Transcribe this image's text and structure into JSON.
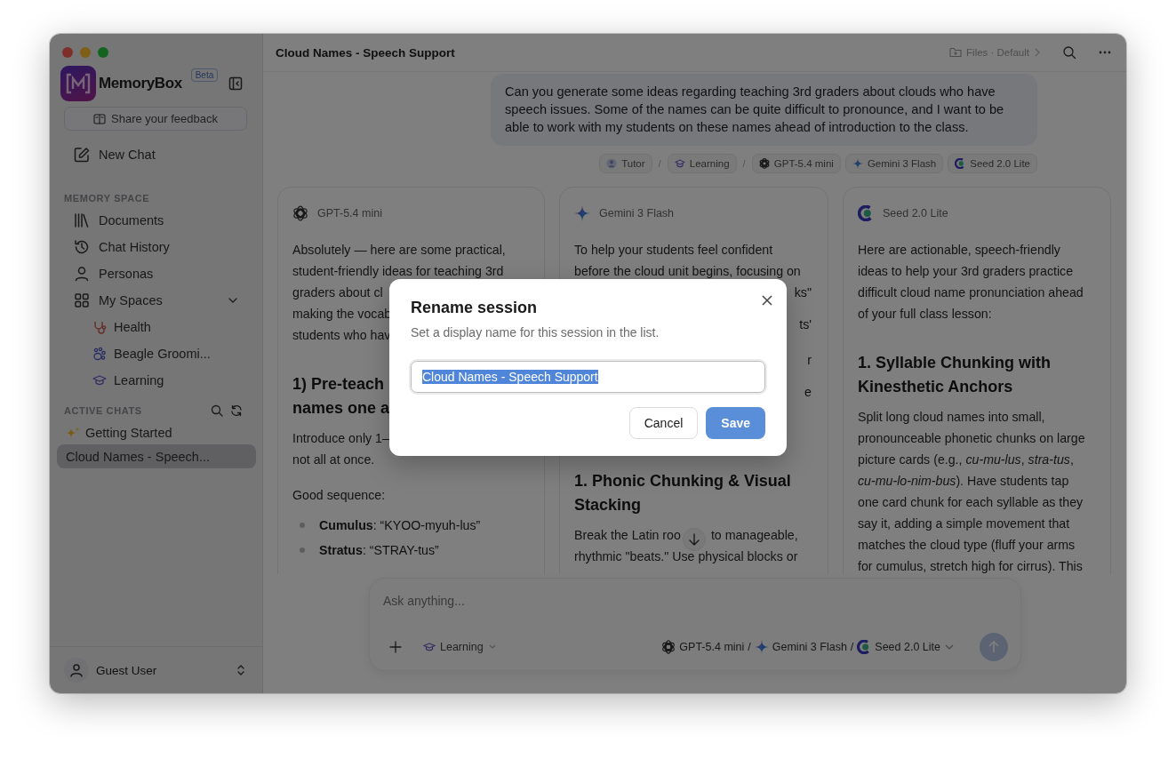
{
  "sidebar": {
    "brand": "MemoryBox",
    "badge": "Beta",
    "feedback": "Share your feedback",
    "new_chat": "New Chat",
    "memory_space": {
      "heading": "MEMORY SPACE",
      "items": [
        {
          "label": "Documents"
        },
        {
          "label": "Chat History"
        },
        {
          "label": "Personas"
        },
        {
          "label": "My Spaces",
          "expanded": true,
          "children": [
            {
              "label": "Health"
            },
            {
              "label": "Beagle Groomi..."
            },
            {
              "label": "Learning"
            }
          ]
        }
      ]
    },
    "active_chats": {
      "heading": "ACTIVE CHATS",
      "items": [
        {
          "label": "Getting Started",
          "selected": false
        },
        {
          "label": "Cloud Names - Speech...",
          "selected": true
        }
      ]
    },
    "user": "Guest User"
  },
  "header": {
    "title": "Cloud Names - Speech Support",
    "files": "Files · Default"
  },
  "message": {
    "text": "Can you generate some ideas regarding teaching 3rd graders about clouds who have speech issues.  Some of the names can be quite difficult to pronounce, and I want to be able to work with my students on these names ahead of introduction to the class.",
    "tags": [
      {
        "kind": "tag",
        "label": "Tutor"
      },
      {
        "kind": "sep",
        "label": "/"
      },
      {
        "kind": "tag",
        "label": "Learning"
      },
      {
        "kind": "sep",
        "label": "/"
      },
      {
        "kind": "model",
        "label": "GPT-5.4 mini"
      },
      {
        "kind": "model",
        "label": "Gemini 3 Flash"
      },
      {
        "kind": "model",
        "label": "Seed 2.0 Lite"
      }
    ]
  },
  "cards": [
    {
      "model": "GPT-5.4 mini",
      "blocks": [
        {
          "kind": "p",
          "lines": [
            "Absolutely — here are some practical,",
            "student-friendly ideas for teaching 3rd",
            "graders about cl",
            "making the vocab",
            "students who hav"
          ]
        },
        {
          "kind": "h",
          "lines": [
            "1) Pre-teach",
            "names one a"
          ]
        },
        {
          "kind": "p",
          "lines": [
            "Introduce only 1–",
            "not all at once."
          ]
        },
        {
          "kind": "p",
          "lines": [
            "Good sequence:"
          ]
        },
        {
          "kind": "bullet",
          "text": "**Cumulus**: “KYOO-myuh-lus”"
        },
        {
          "kind": "bullet",
          "text": "**Stratus**: “STRAY-tus”"
        }
      ]
    },
    {
      "model": "Gemini 3 Flash",
      "blocks": [
        {
          "kind": "p",
          "lines": [
            "To help your students feel confident",
            "before the cloud unit begins, focusing on"
          ]
        },
        {
          "kind": "covered",
          "lines": [
            "ks\"",
            "ts'"
          ]
        },
        {
          "kind": "covered",
          "lines": [
            "r",
            "e"
          ]
        },
        {
          "kind": "h",
          "lines": [
            "1. Phonic Chunking & Visual",
            "Stacking"
          ]
        },
        {
          "kind": "p",
          "lines": [
            [
              "Break the Latin roo",
              "to manageable,"
            ],
            "rhythmic \"beats.\" Use physical blocks or"
          ]
        }
      ]
    },
    {
      "model": "Seed 2.0 Lite",
      "blocks": [
        {
          "kind": "p",
          "lines": [
            "Here are actionable, speech-friendly",
            "ideas to help your 3rd graders practice",
            "difficult cloud name pronunciation ahead",
            "of your full class lesson:"
          ]
        },
        {
          "kind": "h",
          "lines": [
            "1. Syllable Chunking with",
            "Kinesthetic Anchors"
          ]
        },
        {
          "kind": "p",
          "lines": [
            "Split long cloud names into small,",
            "pronounceable phonetic chunks on large",
            "picture cards (e.g., *cu-mu-lus*, *stra-tus*,",
            "*cu-mu-lo-nim-bus*). Have students tap",
            "one card chunk for each syllable as they",
            "say it, adding a simple movement that",
            "matches the cloud type (fluff your arms",
            "for cumulus, stretch high for cirrus). This"
          ]
        }
      ]
    }
  ],
  "composer": {
    "placeholder": "Ask anything...",
    "mode": "Learning",
    "models": [
      {
        "kind": "model",
        "label": "GPT-5.4 mini"
      },
      {
        "kind": "sep",
        "label": "/"
      },
      {
        "kind": "model",
        "label": "Gemini 3 Flash"
      },
      {
        "kind": "sep",
        "label": "/"
      },
      {
        "kind": "model",
        "label": "Seed 2.0 Lite"
      }
    ]
  },
  "dialog": {
    "title": "Rename session",
    "subtitle": "Set a display name for this session in the list.",
    "value": "Cloud Names - Speech Support",
    "selected": true,
    "cancel": "Cancel",
    "save": "Save"
  }
}
